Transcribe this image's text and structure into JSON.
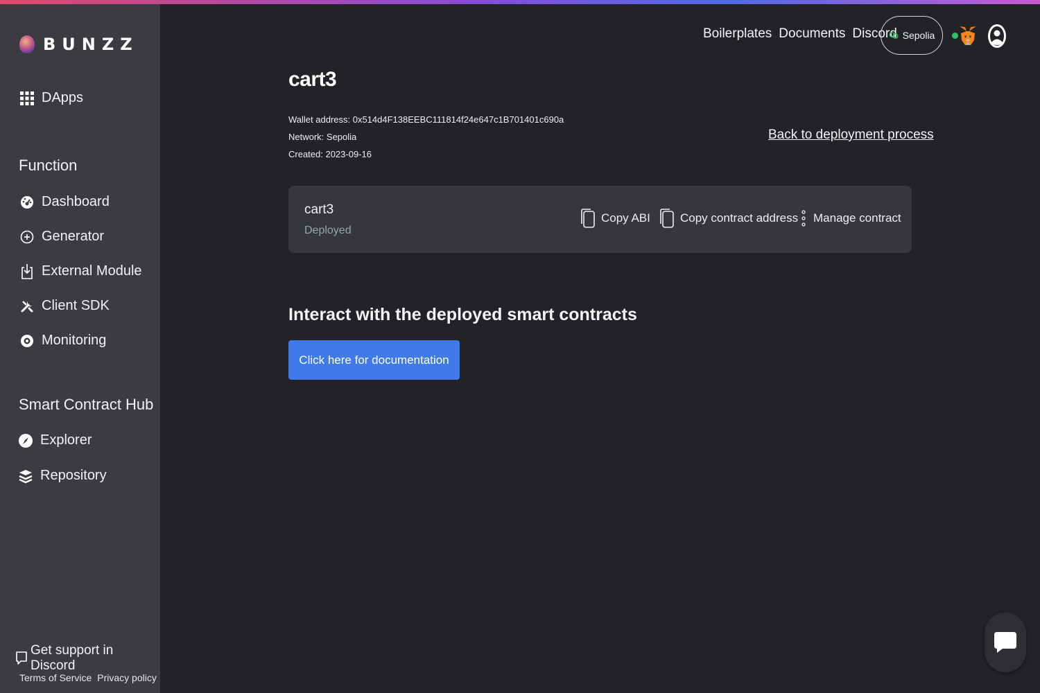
{
  "app": {
    "logo_text": "BUNZZ"
  },
  "sidebar": {
    "dapps_label": "DApps",
    "function_title": "Function",
    "function_items": [
      {
        "label": "Dashboard",
        "icon": "dashboard-icon"
      },
      {
        "label": "Generator",
        "icon": "plus-circle-icon"
      },
      {
        "label": "External Module",
        "icon": "import-icon"
      },
      {
        "label": "Client SDK",
        "icon": "tools-icon"
      },
      {
        "label": "Monitoring",
        "icon": "eye-icon"
      }
    ],
    "hub_title": "Smart Contract Hub",
    "hub_items": [
      {
        "label": "Explorer",
        "icon": "compass-icon"
      },
      {
        "label": "Repository",
        "icon": "layers-icon"
      }
    ],
    "support_label": "Get support in Discord",
    "terms_label": "Terms of Service",
    "privacy_label": "Privacy policy"
  },
  "header": {
    "links": [
      "Boilerplates",
      "Documents",
      "Discord"
    ],
    "network": "Sepolia",
    "wallet_status_color": "#2ec46d"
  },
  "main": {
    "title": "cart3",
    "wallet_address": "Wallet address: 0x514d4F138EEBC111814f24e647c1B701401c690a",
    "network": "Network: Sepolia",
    "created": "Created: 2023-09-16",
    "back_link": "Back to deployment process",
    "card": {
      "name": "cart3",
      "status": "Deployed",
      "copy_abi": "Copy ABI",
      "copy_address": "Copy contract address",
      "manage": "Manage contract"
    },
    "interact_title": "Interact with the deployed smart contracts",
    "doc_button": "Click here for documentation"
  },
  "colors": {
    "background": "#222326",
    "sidebar": "#3a3c41",
    "card": "#35373c",
    "primary_button": "#3f7ae8"
  }
}
